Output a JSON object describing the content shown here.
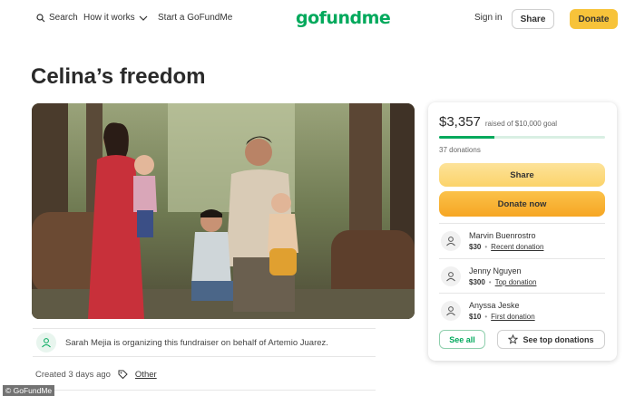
{
  "nav": {
    "search_label": "Search",
    "how_it_works_label": "How it works",
    "start_label": "Start a GoFundMe",
    "logo_text": "gofundme",
    "signin_label": "Sign in",
    "share_label": "Share",
    "donate_label": "Donate"
  },
  "campaign": {
    "title": "Celina’s freedom",
    "organizer_text": "Sarah Mejia is organizing this fundraiser on behalf of Artemio Juarez.",
    "created_text": "Created 3 days ago",
    "category": "Other"
  },
  "sidebar": {
    "raised_amount": "$3,357",
    "goal_text": "raised of $10,000 goal",
    "progress_fraction": 0.3357,
    "donations_count": "37 donations",
    "share_label": "Share",
    "donate_label": "Donate now",
    "donors": [
      {
        "name": "Marvin Buenrostro",
        "amount": "$30",
        "tag": "Recent donation"
      },
      {
        "name": "Jenny Nguyen",
        "amount": "$300",
        "tag": "Top donation"
      },
      {
        "name": "Anyssa Jeske",
        "amount": "$10",
        "tag": "First donation"
      }
    ],
    "see_all_label": "See all",
    "see_top_label": "See top donations"
  },
  "watermark": "© GoFundMe",
  "colors": {
    "brand_green": "#02a95c",
    "donate_yellow": "#f7c33a",
    "donate_orange": "#f6a623"
  }
}
